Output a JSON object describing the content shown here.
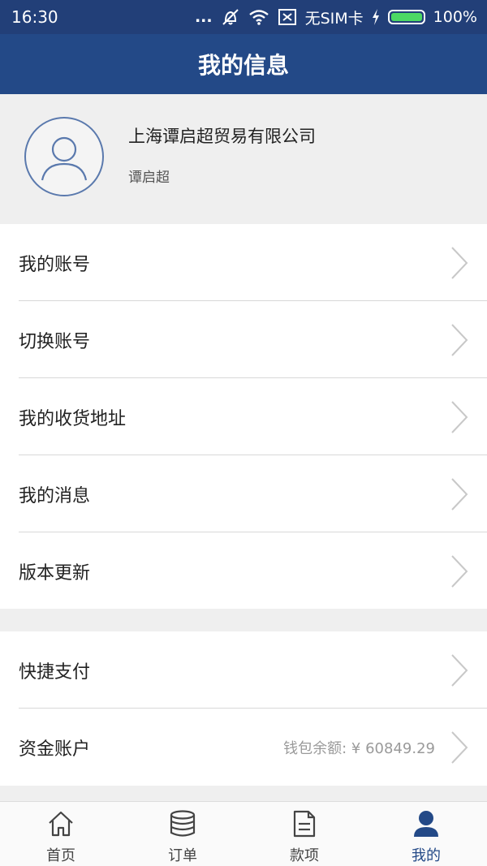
{
  "status_bar": {
    "time": "16:30",
    "dots": "...",
    "sim": "无SIM卡",
    "battery": "100%"
  },
  "header": {
    "title": "我的信息"
  },
  "profile": {
    "company": "上海谭启超贸易有限公司",
    "username": "谭启超"
  },
  "menu_group_1": [
    {
      "label": "我的账号"
    },
    {
      "label": "切换账号"
    },
    {
      "label": "我的收货地址"
    },
    {
      "label": "我的消息"
    },
    {
      "label": "版本更新"
    }
  ],
  "menu_group_2": [
    {
      "label": "快捷支付"
    },
    {
      "label": "资金账户",
      "value": "钱包余额: ¥  60849.29"
    }
  ],
  "tabbar": {
    "tabs": [
      {
        "label": "首页",
        "icon": "home-icon"
      },
      {
        "label": "订单",
        "icon": "database-icon"
      },
      {
        "label": "款项",
        "icon": "document-icon"
      },
      {
        "label": "我的",
        "icon": "user-icon"
      }
    ],
    "active_color": "#234987"
  },
  "colors": {
    "header": "#234987",
    "status_bar": "#223f78"
  }
}
